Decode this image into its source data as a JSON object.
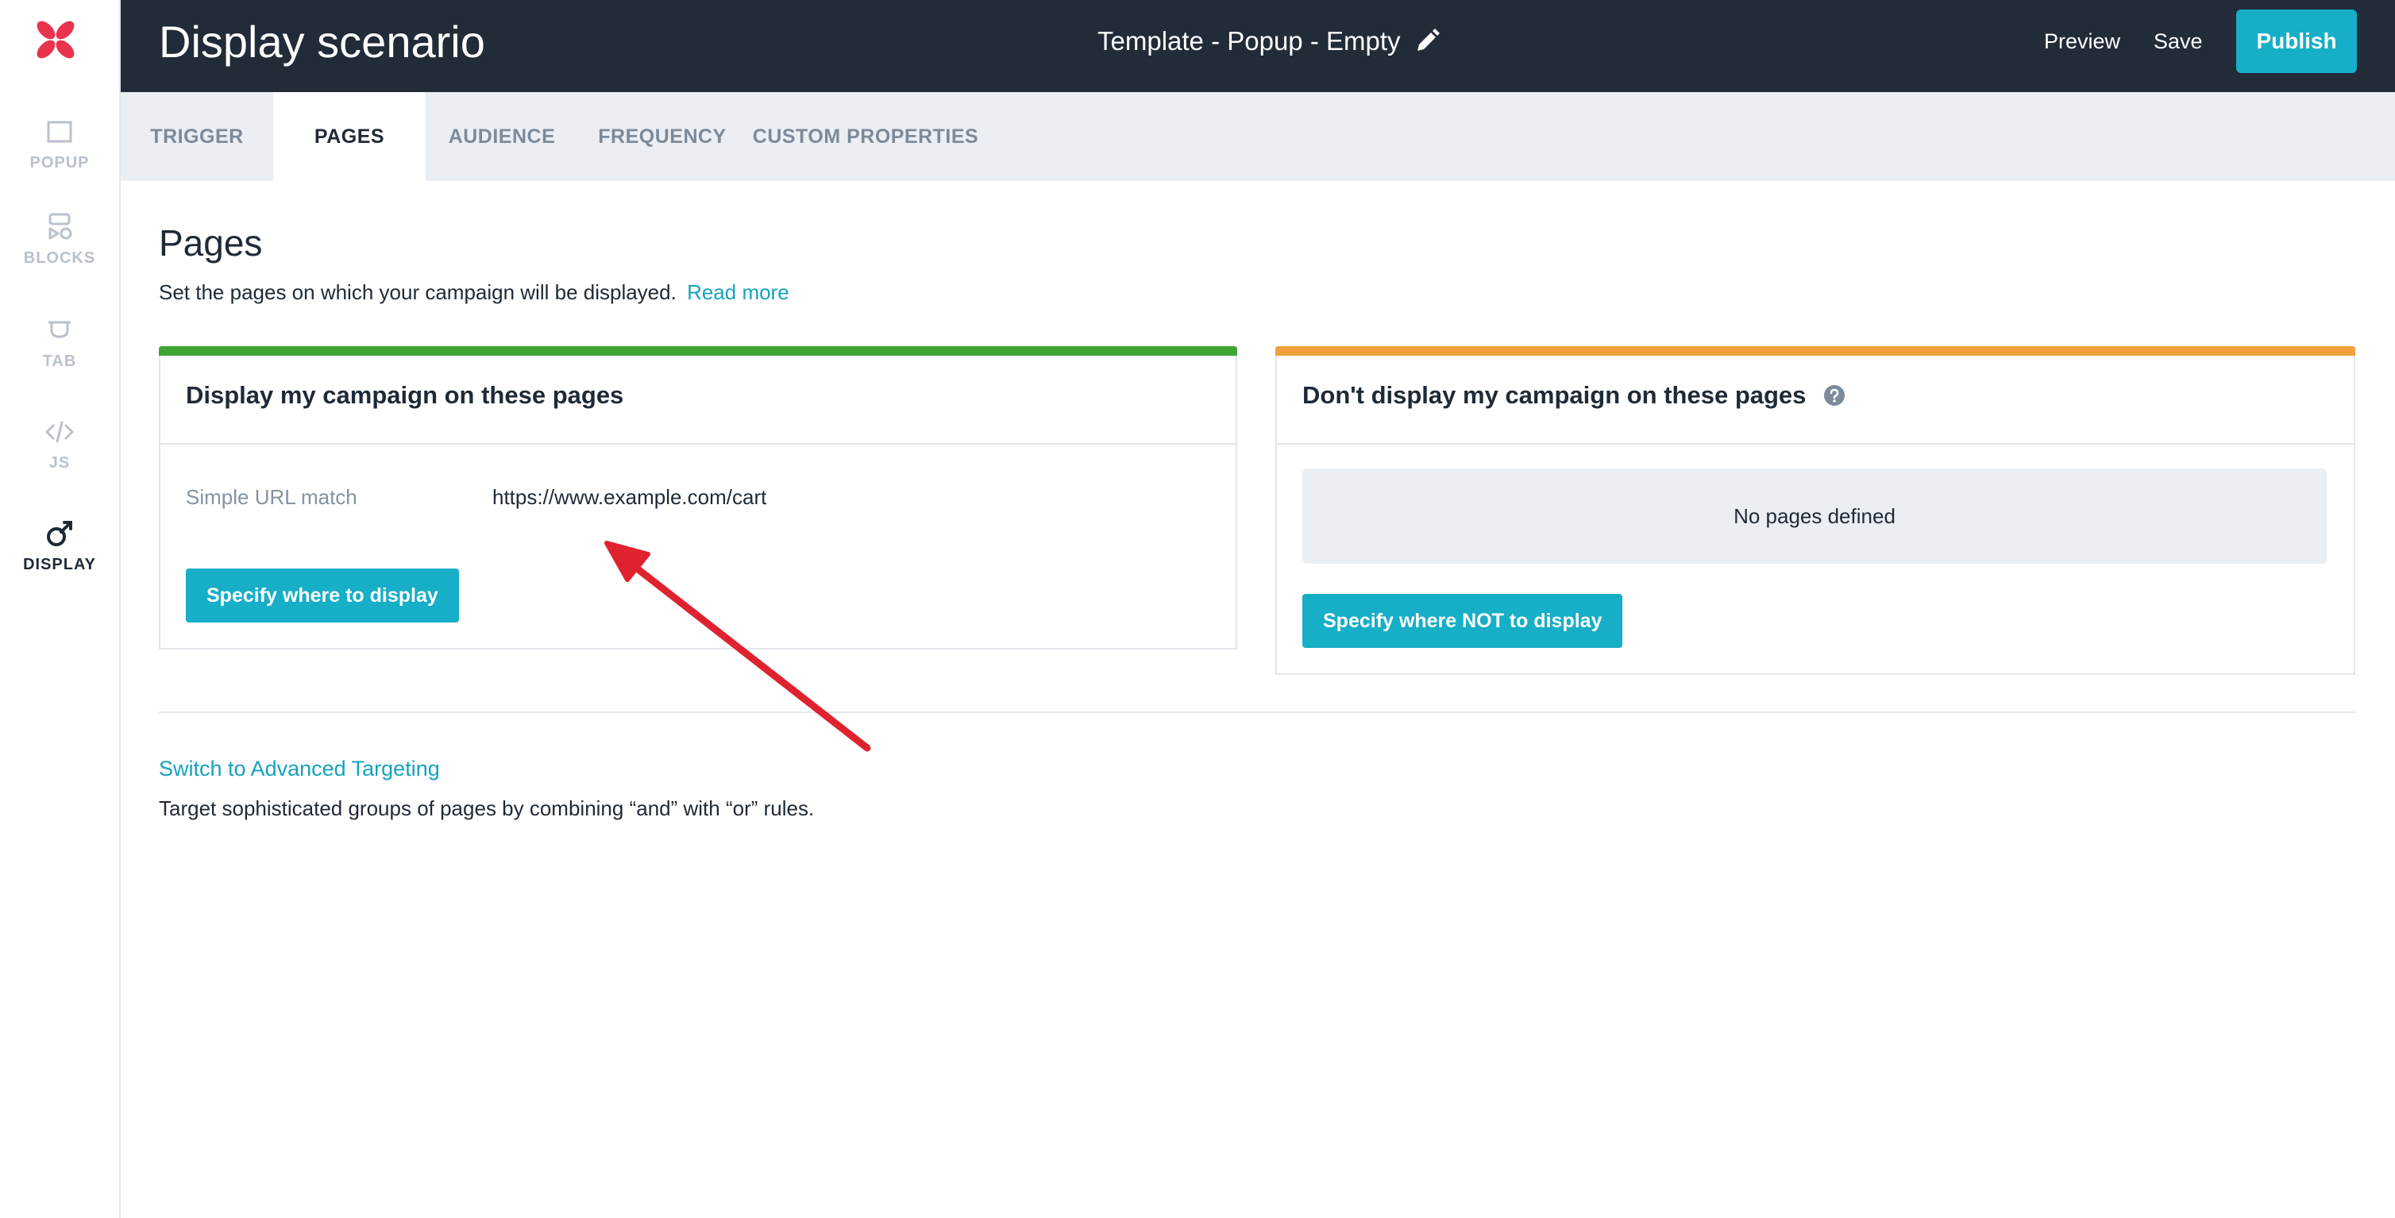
{
  "sidebar": {
    "logo": "brand-logo",
    "items": [
      {
        "label": "POPUP",
        "icon": "popup-icon",
        "active": false
      },
      {
        "label": "BLOCKS",
        "icon": "blocks-icon",
        "active": false
      },
      {
        "label": "TAB",
        "icon": "tab-icon",
        "active": false
      },
      {
        "label": "JS",
        "icon": "code-icon",
        "active": false
      },
      {
        "label": "DISPLAY",
        "icon": "display-icon",
        "active": true
      }
    ]
  },
  "header": {
    "title": "Display scenario",
    "template_name": "Template - Popup - Empty",
    "preview_label": "Preview",
    "save_label": "Save",
    "publish_label": "Publish"
  },
  "tabs": [
    {
      "label": "TRIGGER",
      "active": false
    },
    {
      "label": "PAGES",
      "active": true
    },
    {
      "label": "AUDIENCE",
      "active": false
    },
    {
      "label": "FREQUENCY",
      "active": false
    },
    {
      "label": "CUSTOM PROPERTIES",
      "active": false
    }
  ],
  "main": {
    "heading": "Pages",
    "subtitle": "Set the pages on which your campaign will be displayed.",
    "read_more": "Read more",
    "include_card": {
      "title": "Display my campaign on these pages",
      "rule_label": "Simple URL match",
      "rule_value": "https://www.example.com/cart",
      "button": "Specify where to display",
      "accent": "#3fa535"
    },
    "exclude_card": {
      "title": "Don't display my campaign on these pages",
      "empty_text": "No pages defined",
      "button": "Specify where NOT to display",
      "accent": "#f0a03c"
    },
    "advanced_link": "Switch to Advanced Targeting",
    "advanced_desc": "Target sophisticated groups of pages by combining “and” with “or” rules."
  },
  "colors": {
    "header_bg": "#222b38",
    "primary": "#17aec7",
    "annotation_arrow": "#e0222e"
  }
}
